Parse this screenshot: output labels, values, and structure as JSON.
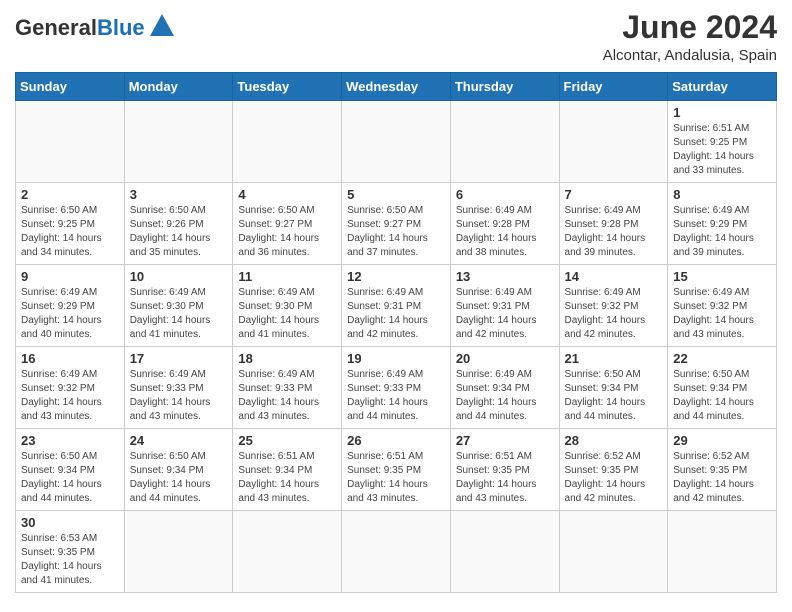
{
  "header": {
    "logo_general": "General",
    "logo_blue": "Blue",
    "month_year": "June 2024",
    "location": "Alcontar, Andalusia, Spain"
  },
  "days_of_week": [
    "Sunday",
    "Monday",
    "Tuesday",
    "Wednesday",
    "Thursday",
    "Friday",
    "Saturday"
  ],
  "weeks": [
    [
      {
        "day": "",
        "info": ""
      },
      {
        "day": "",
        "info": ""
      },
      {
        "day": "",
        "info": ""
      },
      {
        "day": "",
        "info": ""
      },
      {
        "day": "",
        "info": ""
      },
      {
        "day": "",
        "info": ""
      },
      {
        "day": "1",
        "info": "Sunrise: 6:51 AM\nSunset: 9:25 PM\nDaylight: 14 hours and 33 minutes."
      }
    ],
    [
      {
        "day": "2",
        "info": "Sunrise: 6:50 AM\nSunset: 9:25 PM\nDaylight: 14 hours and 34 minutes."
      },
      {
        "day": "3",
        "info": "Sunrise: 6:50 AM\nSunset: 9:26 PM\nDaylight: 14 hours and 35 minutes."
      },
      {
        "day": "4",
        "info": "Sunrise: 6:50 AM\nSunset: 9:27 PM\nDaylight: 14 hours and 36 minutes."
      },
      {
        "day": "5",
        "info": "Sunrise: 6:50 AM\nSunset: 9:27 PM\nDaylight: 14 hours and 37 minutes."
      },
      {
        "day": "6",
        "info": "Sunrise: 6:49 AM\nSunset: 9:28 PM\nDaylight: 14 hours and 38 minutes."
      },
      {
        "day": "7",
        "info": "Sunrise: 6:49 AM\nSunset: 9:28 PM\nDaylight: 14 hours and 39 minutes."
      },
      {
        "day": "8",
        "info": "Sunrise: 6:49 AM\nSunset: 9:29 PM\nDaylight: 14 hours and 39 minutes."
      }
    ],
    [
      {
        "day": "9",
        "info": "Sunrise: 6:49 AM\nSunset: 9:29 PM\nDaylight: 14 hours and 40 minutes."
      },
      {
        "day": "10",
        "info": "Sunrise: 6:49 AM\nSunset: 9:30 PM\nDaylight: 14 hours and 41 minutes."
      },
      {
        "day": "11",
        "info": "Sunrise: 6:49 AM\nSunset: 9:30 PM\nDaylight: 14 hours and 41 minutes."
      },
      {
        "day": "12",
        "info": "Sunrise: 6:49 AM\nSunset: 9:31 PM\nDaylight: 14 hours and 42 minutes."
      },
      {
        "day": "13",
        "info": "Sunrise: 6:49 AM\nSunset: 9:31 PM\nDaylight: 14 hours and 42 minutes."
      },
      {
        "day": "14",
        "info": "Sunrise: 6:49 AM\nSunset: 9:32 PM\nDaylight: 14 hours and 42 minutes."
      },
      {
        "day": "15",
        "info": "Sunrise: 6:49 AM\nSunset: 9:32 PM\nDaylight: 14 hours and 43 minutes."
      }
    ],
    [
      {
        "day": "16",
        "info": "Sunrise: 6:49 AM\nSunset: 9:32 PM\nDaylight: 14 hours and 43 minutes."
      },
      {
        "day": "17",
        "info": "Sunrise: 6:49 AM\nSunset: 9:33 PM\nDaylight: 14 hours and 43 minutes."
      },
      {
        "day": "18",
        "info": "Sunrise: 6:49 AM\nSunset: 9:33 PM\nDaylight: 14 hours and 43 minutes."
      },
      {
        "day": "19",
        "info": "Sunrise: 6:49 AM\nSunset: 9:33 PM\nDaylight: 14 hours and 44 minutes."
      },
      {
        "day": "20",
        "info": "Sunrise: 6:49 AM\nSunset: 9:34 PM\nDaylight: 14 hours and 44 minutes."
      },
      {
        "day": "21",
        "info": "Sunrise: 6:50 AM\nSunset: 9:34 PM\nDaylight: 14 hours and 44 minutes."
      },
      {
        "day": "22",
        "info": "Sunrise: 6:50 AM\nSunset: 9:34 PM\nDaylight: 14 hours and 44 minutes."
      }
    ],
    [
      {
        "day": "23",
        "info": "Sunrise: 6:50 AM\nSunset: 9:34 PM\nDaylight: 14 hours and 44 minutes."
      },
      {
        "day": "24",
        "info": "Sunrise: 6:50 AM\nSunset: 9:34 PM\nDaylight: 14 hours and 44 minutes."
      },
      {
        "day": "25",
        "info": "Sunrise: 6:51 AM\nSunset: 9:34 PM\nDaylight: 14 hours and 43 minutes."
      },
      {
        "day": "26",
        "info": "Sunrise: 6:51 AM\nSunset: 9:35 PM\nDaylight: 14 hours and 43 minutes."
      },
      {
        "day": "27",
        "info": "Sunrise: 6:51 AM\nSunset: 9:35 PM\nDaylight: 14 hours and 43 minutes."
      },
      {
        "day": "28",
        "info": "Sunrise: 6:52 AM\nSunset: 9:35 PM\nDaylight: 14 hours and 42 minutes."
      },
      {
        "day": "29",
        "info": "Sunrise: 6:52 AM\nSunset: 9:35 PM\nDaylight: 14 hours and 42 minutes."
      }
    ],
    [
      {
        "day": "30",
        "info": "Sunrise: 6:53 AM\nSunset: 9:35 PM\nDaylight: 14 hours and 41 minutes."
      },
      {
        "day": "",
        "info": ""
      },
      {
        "day": "",
        "info": ""
      },
      {
        "day": "",
        "info": ""
      },
      {
        "day": "",
        "info": ""
      },
      {
        "day": "",
        "info": ""
      },
      {
        "day": "",
        "info": ""
      }
    ]
  ]
}
